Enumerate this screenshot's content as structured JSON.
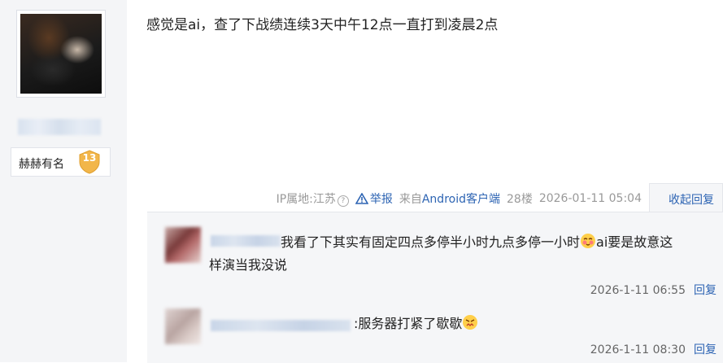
{
  "author": {
    "username": "",
    "rank_name": "赫赫有名",
    "rank_level": "13"
  },
  "post": {
    "content": "感觉是ai，查了下战绩连续3天中午12点一直打到凌晨2点"
  },
  "tail": {
    "ip_location": "IP属地:江苏",
    "report_label": "举报",
    "client_prefix": "来自",
    "client_name": "Android客户端",
    "floor": "28楼",
    "timestamp": "2026-01-11 05:04",
    "collapse_label": "收起回复"
  },
  "replies": [
    {
      "text_part1": "我看了下其实有固定四点多停半小时九点多停一小时",
      "emoji1": "blush-emoji",
      "text_part2": "ai要是故意这",
      "text_line2": "样演当我没说",
      "time": "2026-1-11 06:55",
      "reply_label": "回复"
    },
    {
      "text": ":服务器打紧了歇歇",
      "emoji": "angry-emoji",
      "time": "2026-1-11 08:30",
      "reply_label": "回复"
    }
  ],
  "colors": {
    "link": "#2d64b3",
    "badge": "#f2b64a",
    "sidebar_bg": "#f4f5f7",
    "reply_bg": "#f5f6f8"
  }
}
